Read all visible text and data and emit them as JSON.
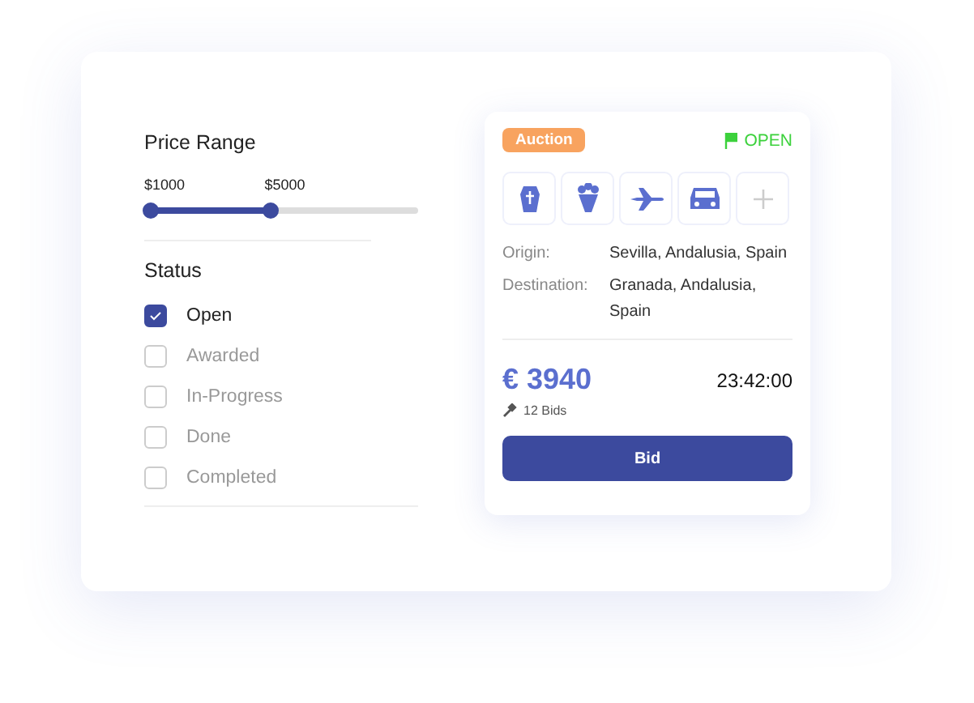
{
  "filters": {
    "price_range": {
      "title": "Price Range",
      "thumbs": [
        {
          "label": "$1000",
          "level": 0
        },
        {
          "label": "$5000",
          "level": 0.45
        }
      ]
    },
    "status": {
      "title": "Status",
      "options": [
        {
          "label": "Open",
          "checked": true
        },
        {
          "label": "Awarded",
          "checked": false
        },
        {
          "label": "In-Progress",
          "checked": false
        },
        {
          "label": "Done",
          "checked": false
        },
        {
          "label": "Completed",
          "checked": false
        }
      ]
    }
  },
  "listing": {
    "badge": "Auction",
    "status": "OPEN",
    "services": [
      {
        "kind": "coffin"
      },
      {
        "kind": "flowers"
      },
      {
        "kind": "plane"
      },
      {
        "kind": "car"
      },
      {
        "kind": "add"
      }
    ],
    "details": [
      {
        "label": "Origin:",
        "value": "Sevilla, Andalusia, Spain"
      },
      {
        "label": "Destination:",
        "value": "Granada, Andalusia, Spain"
      }
    ],
    "price": "€ 3940",
    "time": "23:42:00",
    "bids": "12 Bids",
    "button": "Bid"
  }
}
